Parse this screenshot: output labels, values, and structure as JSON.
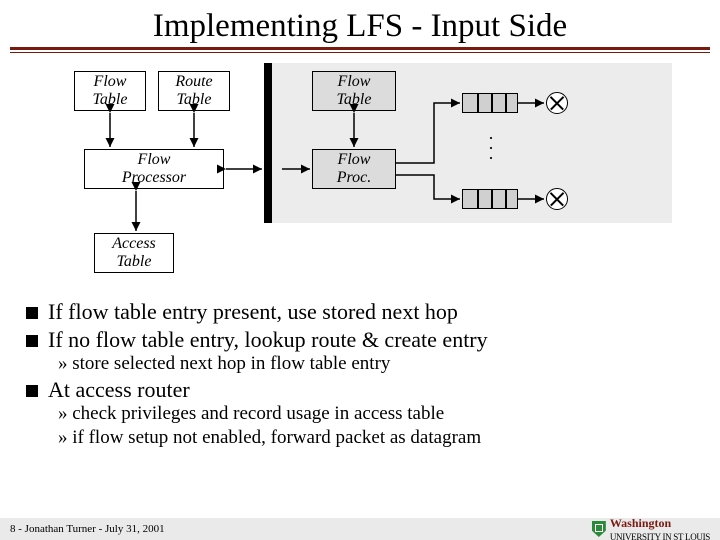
{
  "title": "Implementing LFS - Input Side",
  "diagram": {
    "flow_table": "Flow\nTable",
    "route_table": "Route\nTable",
    "flow_processor": "Flow\nProcessor",
    "access_table": "Access\nTable",
    "flow_table2": "Flow\nTable",
    "flow_proc2": "Flow\nProc."
  },
  "bullets": {
    "l1": "If flow table entry present, use stored next hop",
    "l2": "If no flow table entry, lookup route & create entry",
    "l2a": "» store selected next hop in flow table entry",
    "l3": "At access router",
    "l3a": "» check privileges and record usage in access table",
    "l3b": "» if flow setup not enabled, forward packet as datagram"
  },
  "footer": {
    "left": "8 - Jonathan Turner - July 31, 2001",
    "uni1": "Washington",
    "uni2": "UNIVERSITY IN ST LOUIS"
  }
}
